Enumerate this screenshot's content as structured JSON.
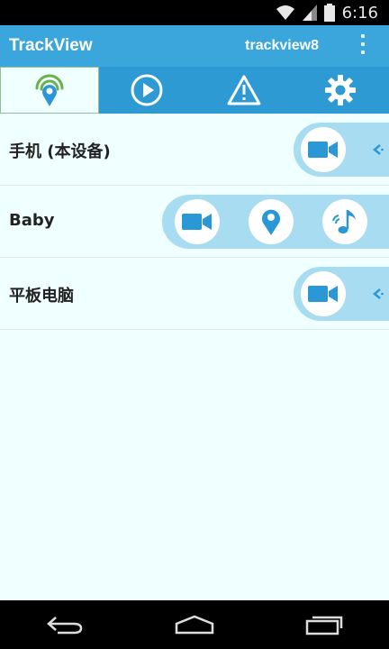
{
  "status_bar": {
    "time": "6:16"
  },
  "app_bar": {
    "title": "TrackView",
    "account": "trackview8"
  },
  "tabs": [
    {
      "name": "location",
      "active": true
    },
    {
      "name": "playback",
      "active": false
    },
    {
      "name": "alerts",
      "active": false
    },
    {
      "name": "settings",
      "active": false
    }
  ],
  "devices": [
    {
      "name": "手机 (本设备)",
      "actions": [
        "video-camera"
      ],
      "collapsible": true
    },
    {
      "name": "Baby",
      "actions": [
        "video-camera",
        "location-pin",
        "sound"
      ],
      "collapsible": false
    },
    {
      "name": "平板电脑",
      "actions": [
        "video-camera"
      ],
      "collapsible": true
    }
  ],
  "colors": {
    "app_bar": "#3aa6dc",
    "tab_bar": "#2e9ad3",
    "background": "#f0ffff",
    "panel": "#a7dcf1",
    "icon_blue": "#2a98d6"
  }
}
